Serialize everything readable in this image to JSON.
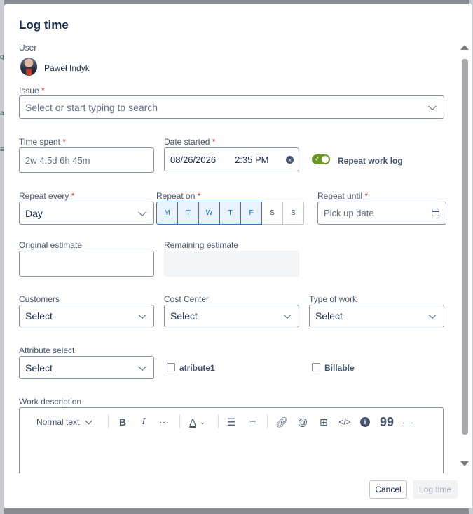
{
  "dialog": {
    "title": "Log time",
    "user": {
      "label": "User",
      "name": "Paweł Indyk"
    },
    "issue": {
      "label": "Issue",
      "required": "*",
      "placeholder": "Select or start typing to search"
    },
    "time_spent": {
      "label": "Time spent",
      "required": "*",
      "placeholder": "2w 4.5d 6h 45m"
    },
    "date_started": {
      "label": "Date started",
      "required": "*",
      "date": "08/26/2026",
      "time": "2:35 PM"
    },
    "repeat_toggle": {
      "label": "Repeat work log",
      "on": true
    },
    "repeat_every": {
      "label": "Repeat every",
      "required": "*",
      "value": "Day"
    },
    "repeat_on": {
      "label": "Repeat on",
      "required": "*",
      "days": [
        {
          "letter": "M",
          "on": true
        },
        {
          "letter": "T",
          "on": true
        },
        {
          "letter": "W",
          "on": true
        },
        {
          "letter": "T",
          "on": true
        },
        {
          "letter": "F",
          "on": true
        },
        {
          "letter": "S",
          "on": false
        },
        {
          "letter": "S",
          "on": false
        }
      ]
    },
    "repeat_until": {
      "label": "Repeat until",
      "required": "*",
      "placeholder": "Pick up date"
    },
    "original_estimate": {
      "label": "Original estimate",
      "value": ""
    },
    "remaining_estimate": {
      "label": "Remaining estimate",
      "value": ""
    },
    "customers": {
      "label": "Customers",
      "value": "Select"
    },
    "cost_center": {
      "label": "Cost Center",
      "value": "Select"
    },
    "type_of_work": {
      "label": "Type of work",
      "value": "Select"
    },
    "attribute_select": {
      "label": "Attribute select",
      "value": "Select"
    },
    "checkboxes": {
      "atribute1": "atribute1",
      "billable": "Billable"
    },
    "work_description": {
      "label": "Work description",
      "text_style": "Normal text"
    },
    "buttons": {
      "cancel": "Cancel",
      "log_time": "Log time"
    }
  },
  "background": {
    "left_fragments": [
      "g",
      "at",
      "≡"
    ]
  }
}
